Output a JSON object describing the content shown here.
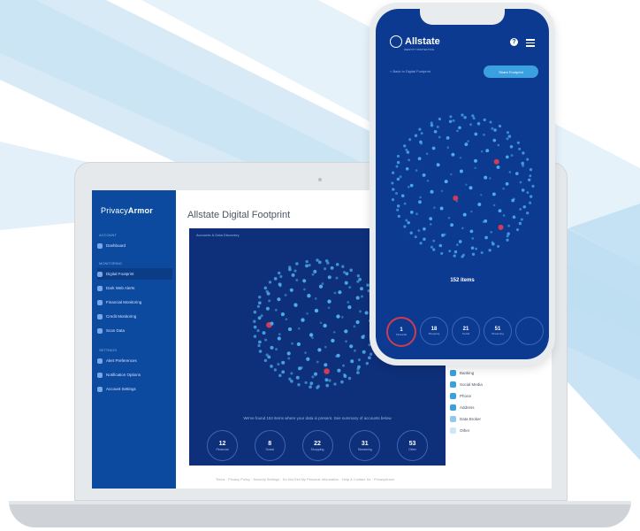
{
  "laptop": {
    "brand_prefix": "Privacy",
    "brand_suffix": "Armor",
    "sidebar": {
      "section_top": "Account",
      "top_item": "Dashboard",
      "section_mid": "Monitoring",
      "items": [
        {
          "label": "Digital Footprint",
          "active": true
        },
        {
          "label": "Dark Web Alerts",
          "active": false
        },
        {
          "label": "Financial Monitoring",
          "active": false
        },
        {
          "label": "Credit Monitoring",
          "active": false
        },
        {
          "label": "Scan Data",
          "active": false
        }
      ],
      "section_bottom": "Settings",
      "bottom_items": [
        {
          "label": "Alert Preferences"
        },
        {
          "label": "Notification Options"
        },
        {
          "label": "Account Settings"
        }
      ]
    },
    "main_title": "Allstate Digital Footprint",
    "panel_label": "Accounts & Data Discovery",
    "panel_caption": "We've found 152 items where your data is present. See summary of accounts below",
    "stats": [
      {
        "number": "12",
        "label": "Financial"
      },
      {
        "number": "8",
        "label": "Social"
      },
      {
        "number": "22",
        "label": "Shopping"
      },
      {
        "number": "31",
        "label": "Streaming"
      },
      {
        "number": "53",
        "label": "Other"
      }
    ],
    "legend": [
      {
        "label": "Banking",
        "color": "#3aa0e0"
      },
      {
        "label": "Social Media",
        "color": "#3aa0e0"
      },
      {
        "label": "Phone",
        "color": "#3aa0e0"
      },
      {
        "label": "Address",
        "color": "#3aa0e0"
      },
      {
        "label": "Data Broker",
        "color": "#8fc8ee"
      },
      {
        "label": "Other",
        "color": "#cfe6f7"
      }
    ],
    "footer": "Terms · Privacy Policy · Security Settings · Do Not Sell My Personal Information · Help & Contact Us · PrivacyArmor"
  },
  "phone": {
    "logo": "Allstate",
    "logo_tag": "IDENTITY PROTECTION",
    "back_link": "< Back to Digital Footprint",
    "pill_button": "Share Footprint",
    "items_label": "152 items",
    "stats": [
      {
        "number": "1",
        "label": "Financial",
        "selected": true
      },
      {
        "number": "18",
        "label": "Shopping",
        "selected": false
      },
      {
        "number": "21",
        "label": "Social",
        "selected": false
      },
      {
        "number": "51",
        "label": "Streaming",
        "selected": false
      },
      {
        "number": "",
        "label": "",
        "selected": false
      }
    ]
  },
  "icons": [
    "help-icon",
    "menu-icon",
    "camera-icon"
  ],
  "colors": {
    "sidebar": "#0b4a9e",
    "panel": "#0e2f7a",
    "dot": "#4fb0f0",
    "alert_dot": "#d23b50",
    "phone_screen": "#0c3a91"
  }
}
